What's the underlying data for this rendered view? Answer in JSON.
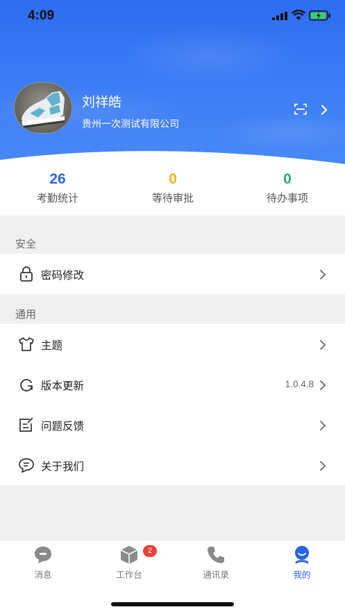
{
  "status_bar": {
    "time": "4:09"
  },
  "profile": {
    "name": "刘祥皓",
    "company": "贵州一次测试有限公司"
  },
  "stats": [
    {
      "value": "26",
      "label": "考勤统计",
      "color": "#2b63e6"
    },
    {
      "value": "0",
      "label": "等待审批",
      "color": "#f2b41b"
    },
    {
      "value": "0",
      "label": "待办事项",
      "color": "#25b06b"
    }
  ],
  "sections": {
    "security": {
      "title": "安全",
      "items": [
        {
          "label": "密码修改",
          "icon": "lock-icon"
        }
      ]
    },
    "general": {
      "title": "通用",
      "items": [
        {
          "label": "主题",
          "icon": "tshirt-icon"
        },
        {
          "label": "版本更新",
          "icon": "refresh-icon",
          "value": "1.0.4.8"
        },
        {
          "label": "问题反馈",
          "icon": "feedback-icon"
        },
        {
          "label": "关于我们",
          "icon": "chat-bubble-icon"
        }
      ]
    }
  },
  "tabbar": {
    "active": "我的",
    "accent": "#2b63e6",
    "tabs": [
      {
        "label": "消息",
        "icon": "message-icon"
      },
      {
        "label": "工作台",
        "icon": "cube-icon",
        "badge": "2"
      },
      {
        "label": "通讯录",
        "icon": "phone-icon"
      },
      {
        "label": "我的",
        "icon": "profile-icon"
      }
    ]
  }
}
